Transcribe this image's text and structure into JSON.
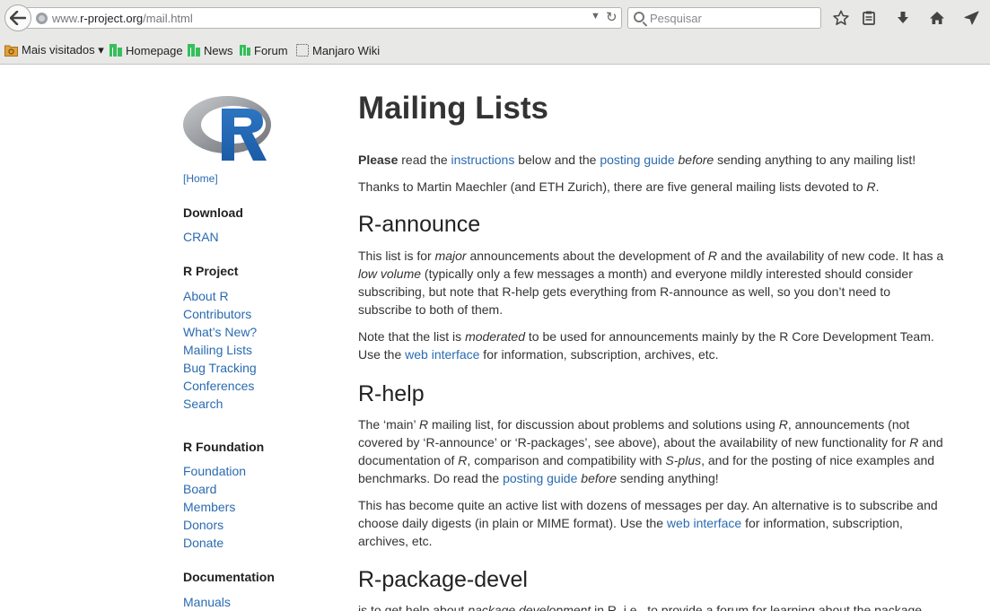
{
  "browser": {
    "url_prefix": "www.",
    "url_host": "r-project.org",
    "url_path": "/mail.html",
    "search_placeholder": "Pesquisar",
    "bookmarks": [
      {
        "label": "Mais visitados ▾"
      },
      {
        "label": "Homepage"
      },
      {
        "label": "News"
      },
      {
        "label": "Forum"
      },
      {
        "label": "Manjaro Wiki"
      }
    ]
  },
  "sidebar": {
    "home_label": "[Home]",
    "sections": [
      {
        "heading": "Download",
        "links": [
          "CRAN"
        ]
      },
      {
        "heading": "R Project",
        "links": [
          "About R",
          "Contributors",
          "What’s New?",
          "Mailing Lists",
          "Bug Tracking",
          "Conferences",
          "Search"
        ]
      },
      {
        "heading": "R Foundation",
        "links": [
          "Foundation",
          "Board",
          "Members",
          "Donors",
          "Donate"
        ]
      },
      {
        "heading": "Documentation",
        "links": [
          "Manuals"
        ]
      }
    ]
  },
  "main": {
    "title": "Mailing Lists",
    "intro": {
      "please": "Please",
      "read_the": " read the ",
      "instructions": "instructions",
      "below_and_the": " below and the ",
      "posting_guide": "posting guide",
      "before": "before",
      "rest": " sending anything to any mailing list!"
    },
    "thanks": {
      "text": "Thanks to Martin Maechler (and ETH Zurich), there are five general mailing lists devoted to ",
      "r": "R",
      "end": "."
    },
    "r_announce": {
      "heading": "R-announce",
      "p1": {
        "a": "This list is for ",
        "major": "major",
        "b": " announcements about the development of ",
        "r": "R",
        "c": " and the availability of new code. It has a ",
        "low_volume": "low volume",
        "d": " (typically only a few messages a month) and everyone mildly interested should consider subscribing, but note that R-help gets everything from R-announce as well, so you don’t need to subscribe to both of them."
      },
      "p2": {
        "a": "Note that the list is ",
        "moderated": "moderated",
        "b": " to be used for announcements mainly by the R Core Development Team. Use the ",
        "web_interface": "web interface",
        "c": " for information, subscription, archives, etc."
      }
    },
    "r_help": {
      "heading": "R-help",
      "p1": {
        "a": "The ‘main’ ",
        "r1": "R",
        "b": " mailing list, for discussion about problems and solutions using ",
        "r2": "R",
        "c": ", announcements (not covered by ‘R-announce’ or ‘R-packages’, see above), about the availability of new functionality for ",
        "r3": "R",
        "d": " and documentation of ",
        "r4": "R",
        "e": ", comparison and compatibility with ",
        "splus": "S-plus",
        "f": ", and for the posting of nice examples and benchmarks. Do read the ",
        "posting_guide": "posting guide",
        "g": " ",
        "before": "before",
        "h": " sending anything!"
      },
      "p2": {
        "a": "This has become quite an active list with dozens of messages per day. An alternative is to subscribe and choose daily digests (in plain or MIME format). Use the ",
        "web_interface": "web interface",
        "b": " for information, subscription, archives, etc."
      }
    },
    "r_package_devel": {
      "heading": "R-package-devel",
      "p1": {
        "a": "is to get help about ",
        "package_development": "package development",
        "b": " in R, i.e., to provide a forum for learning about the package"
      }
    }
  }
}
